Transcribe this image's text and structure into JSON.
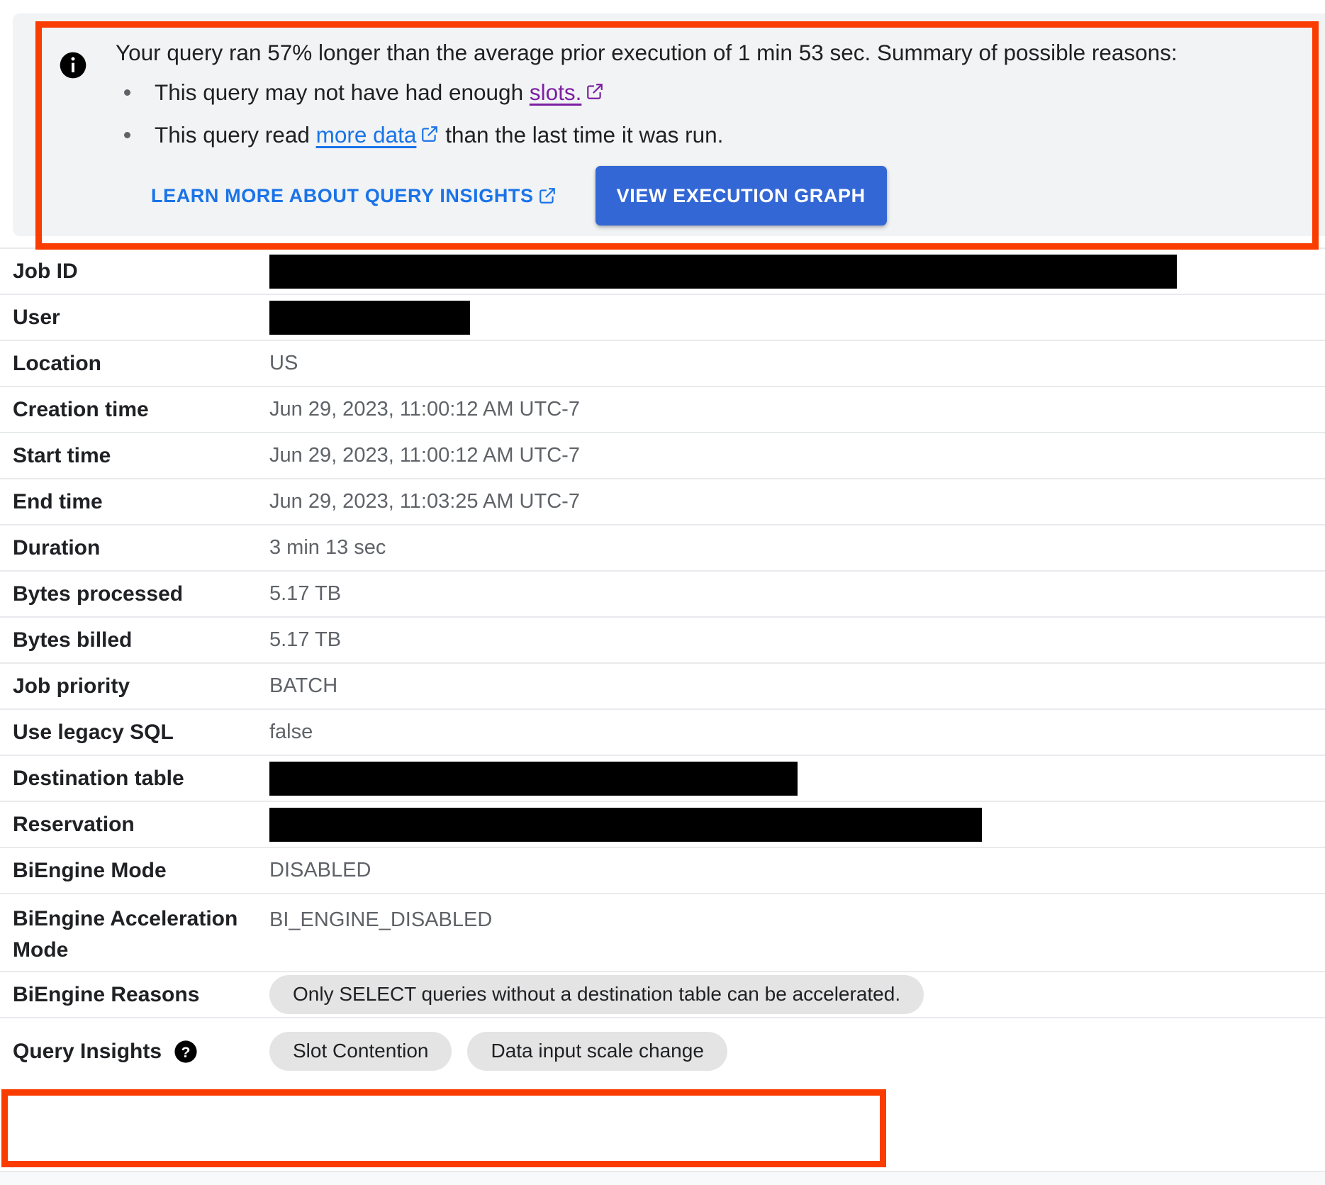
{
  "banner": {
    "icon": "info-icon",
    "headline_part1": "Your query ran 57% longer than the average prior execution of 1 min 53 sec. Summary of possible reasons:",
    "bullets": [
      {
        "prefix": "This query may not have had enough ",
        "link_text": "slots.",
        "link_style": "purple",
        "suffix": "",
        "external_icon": "external-link-icon"
      },
      {
        "prefix": "This query read ",
        "link_text": "more data",
        "link_style": "blue",
        "suffix": " than the last time it was run.",
        "external_icon": "external-link-icon"
      }
    ],
    "learn_more_label": "LEARN MORE ABOUT QUERY INSIGHTS",
    "view_graph_label": "VIEW EXECUTION GRAPH",
    "accent_blue": "#3367d6",
    "link_blue": "#1a73e8",
    "link_purple": "#7b1fa2",
    "background": "#f1f3f4"
  },
  "annotations": {
    "color": "#fa3c00",
    "boxes": [
      "query-insights-banner",
      "query-insights-row"
    ]
  },
  "details": {
    "rows": [
      {
        "label": "Job ID",
        "type": "redacted",
        "value": ""
      },
      {
        "label": "User",
        "type": "redacted",
        "value": ""
      },
      {
        "label": "Location",
        "type": "text",
        "value": "US"
      },
      {
        "label": "Creation time",
        "type": "text",
        "value": "Jun 29, 2023, 11:00:12 AM UTC-7"
      },
      {
        "label": "Start time",
        "type": "text",
        "value": "Jun 29, 2023, 11:00:12 AM UTC-7"
      },
      {
        "label": "End time",
        "type": "text",
        "value": "Jun 29, 2023, 11:03:25 AM UTC-7"
      },
      {
        "label": "Duration",
        "type": "text",
        "value": "3 min 13 sec"
      },
      {
        "label": "Bytes processed",
        "type": "text",
        "value": "5.17 TB"
      },
      {
        "label": "Bytes billed",
        "type": "text",
        "value": "5.17 TB"
      },
      {
        "label": "Job priority",
        "type": "text",
        "value": "BATCH"
      },
      {
        "label": "Use legacy SQL",
        "type": "text",
        "value": "false"
      },
      {
        "label": "Destination table",
        "type": "redacted",
        "value": ""
      },
      {
        "label": "Reservation",
        "type": "redacted",
        "value": ""
      },
      {
        "label": "BiEngine Mode",
        "type": "text",
        "value": "DISABLED"
      },
      {
        "label": "BiEngine Acceleration Mode",
        "type": "text",
        "value": "BI_ENGINE_DISABLED"
      },
      {
        "label": "BiEngine Reasons",
        "type": "chips",
        "chips": [
          "Only SELECT queries without a destination table can be accelerated."
        ]
      },
      {
        "label": "Query Insights",
        "type": "chips",
        "help_icon": "help-icon",
        "chips": [
          "Slot Contention",
          "Data input scale change"
        ]
      }
    ]
  }
}
